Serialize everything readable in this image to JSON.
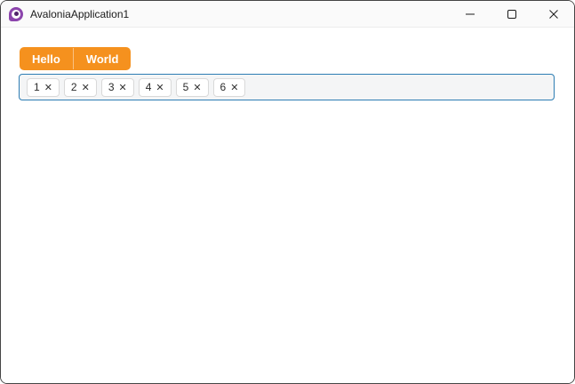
{
  "colors": {
    "accent": "#F5911E",
    "focus-border": "#2D7DB3",
    "window-border": "#454545",
    "titlebar-bg": "#FAFAFA",
    "chipsbox-bg": "#F4F5F6",
    "chip-border": "#D9D9D9",
    "text": "#1B1B1B",
    "logo-purple": "#8B44AC",
    "logo-dark": "#51246B"
  },
  "titlebar": {
    "title": "AvaloniaApplication1",
    "app_icon": "avalonia-logo",
    "buttons": [
      {
        "icon": "minimize"
      },
      {
        "icon": "maximize"
      },
      {
        "icon": "close"
      }
    ]
  },
  "tabs": {
    "items": [
      {
        "label": "Hello"
      },
      {
        "label": "World"
      }
    ]
  },
  "chips": {
    "close_glyph": "✕",
    "items": [
      {
        "label": "1"
      },
      {
        "label": "2"
      },
      {
        "label": "3"
      },
      {
        "label": "4"
      },
      {
        "label": "5"
      },
      {
        "label": "6"
      }
    ]
  }
}
